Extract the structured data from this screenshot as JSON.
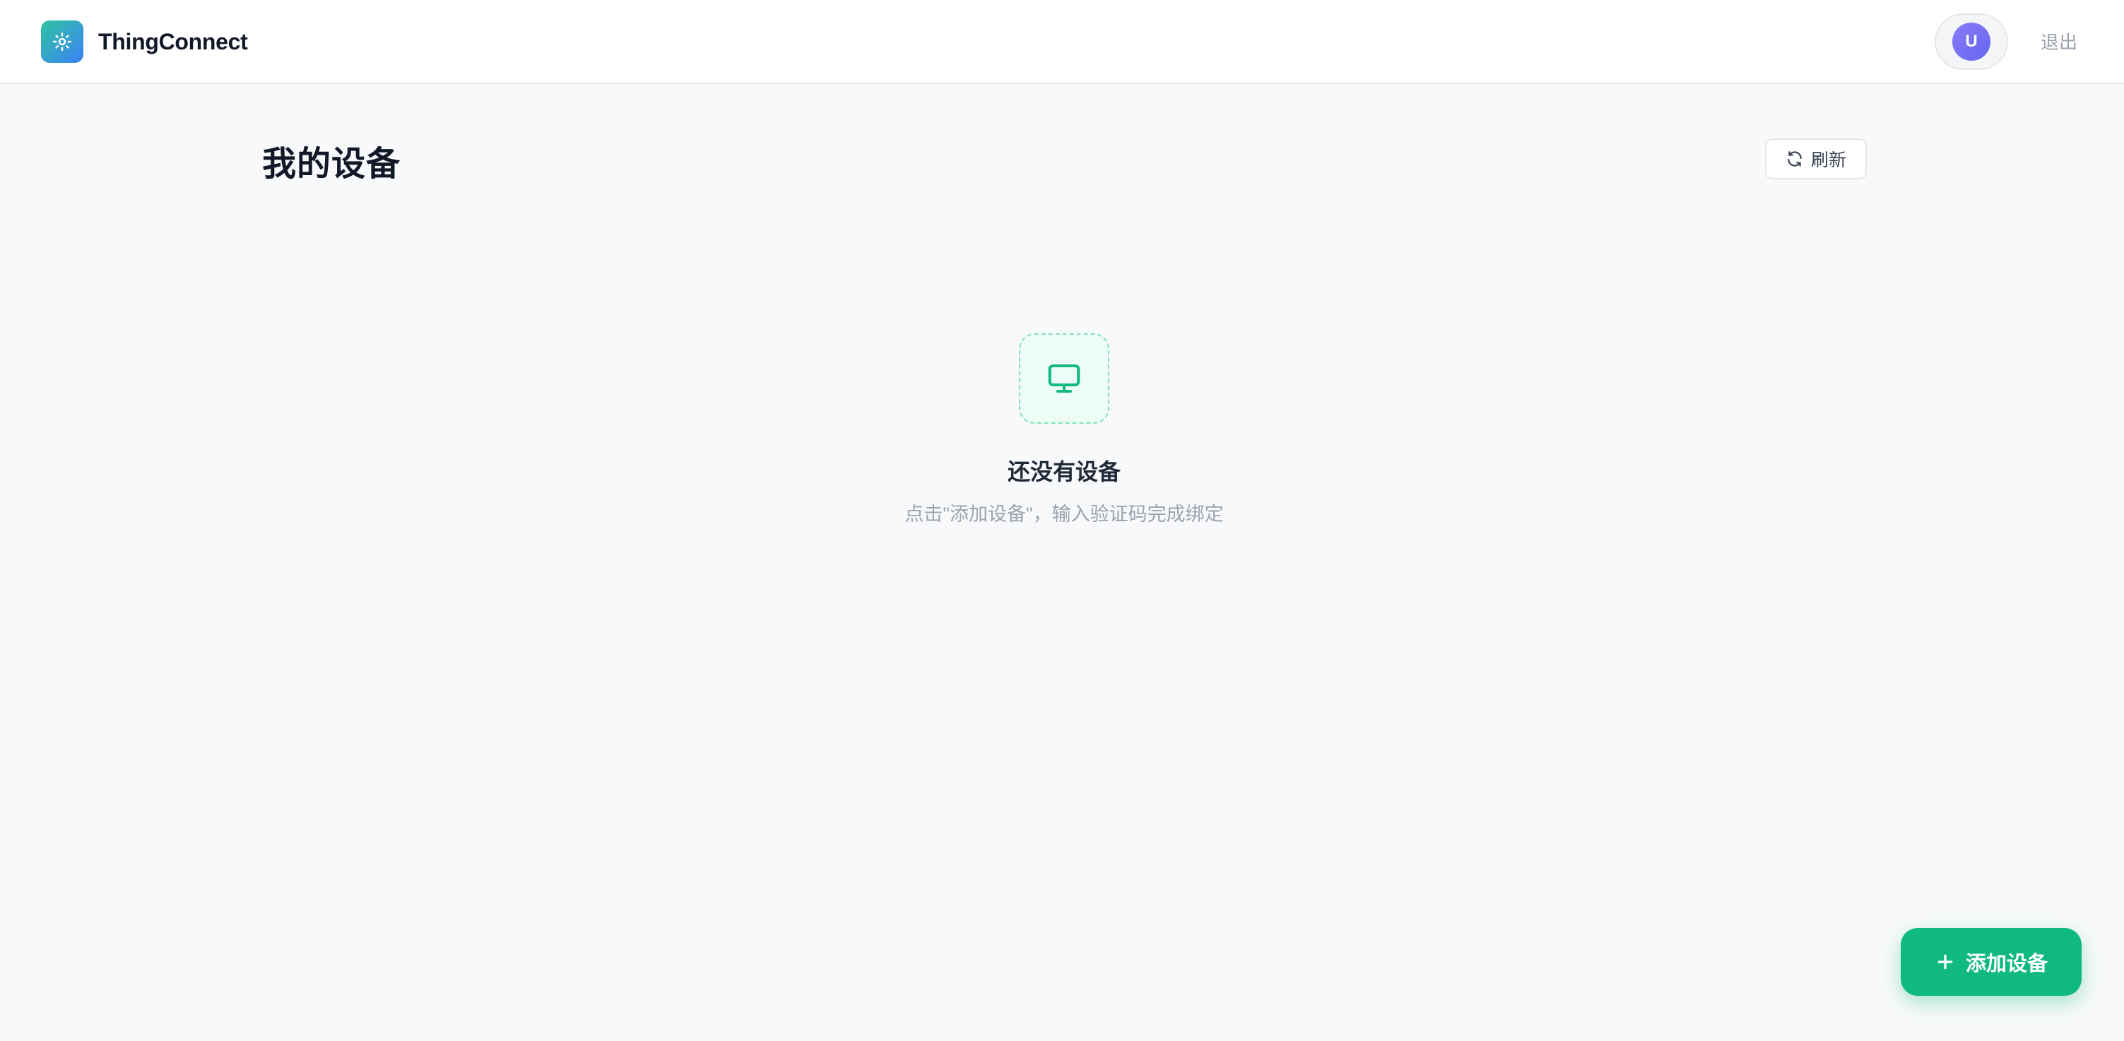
{
  "header": {
    "brand_name": "ThingConnect",
    "logo_icon": "sun-icon",
    "avatar_initial": "U",
    "logout_label": "退出"
  },
  "main": {
    "title": "我的设备",
    "refresh_label": "刷新",
    "refresh_icon": "refresh-icon"
  },
  "empty_state": {
    "icon": "monitor-icon",
    "title": "还没有设备",
    "description": "点击\"添加设备\"，输入验证码完成绑定"
  },
  "fab": {
    "label": "添加设备",
    "icon": "plus-icon"
  },
  "colors": {
    "brand_gradient_start": "#2ec4a0",
    "brand_gradient_end": "#3b82f6",
    "accent_green": "#10b981",
    "avatar_purple": "#6366f1",
    "page_background": "#f8f9fb"
  }
}
